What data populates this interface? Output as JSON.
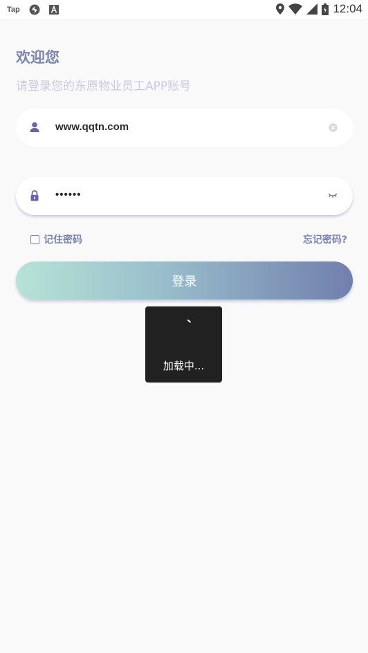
{
  "status_bar": {
    "app_label": "Tap",
    "time": "12:04",
    "icons": [
      "tap-icon",
      "sync-icon",
      "a-icon",
      "location-icon",
      "wifi-icon",
      "signal-icon",
      "battery-icon"
    ]
  },
  "header": {
    "title": "欢迎您",
    "subtitle": "请登录您的东原物业员工APP账号"
  },
  "form": {
    "username": {
      "value": "www.qqtn.com",
      "icon": "user-icon",
      "action_icon": "clear-icon"
    },
    "password": {
      "value": "••••••",
      "icon": "lock-icon",
      "action_icon": "eye-closed-icon"
    },
    "remember_label": "记住密码",
    "remember_checked": false,
    "forgot_label": "忘记密码?",
    "login_label": "登录"
  },
  "loading": {
    "text": "加载中..."
  },
  "colors": {
    "accent": "#7a84ac",
    "subtitle": "#c9cbe2",
    "gradient_start": "#b6e3d6",
    "gradient_end": "#717fad",
    "background": "#f9f9fa"
  }
}
